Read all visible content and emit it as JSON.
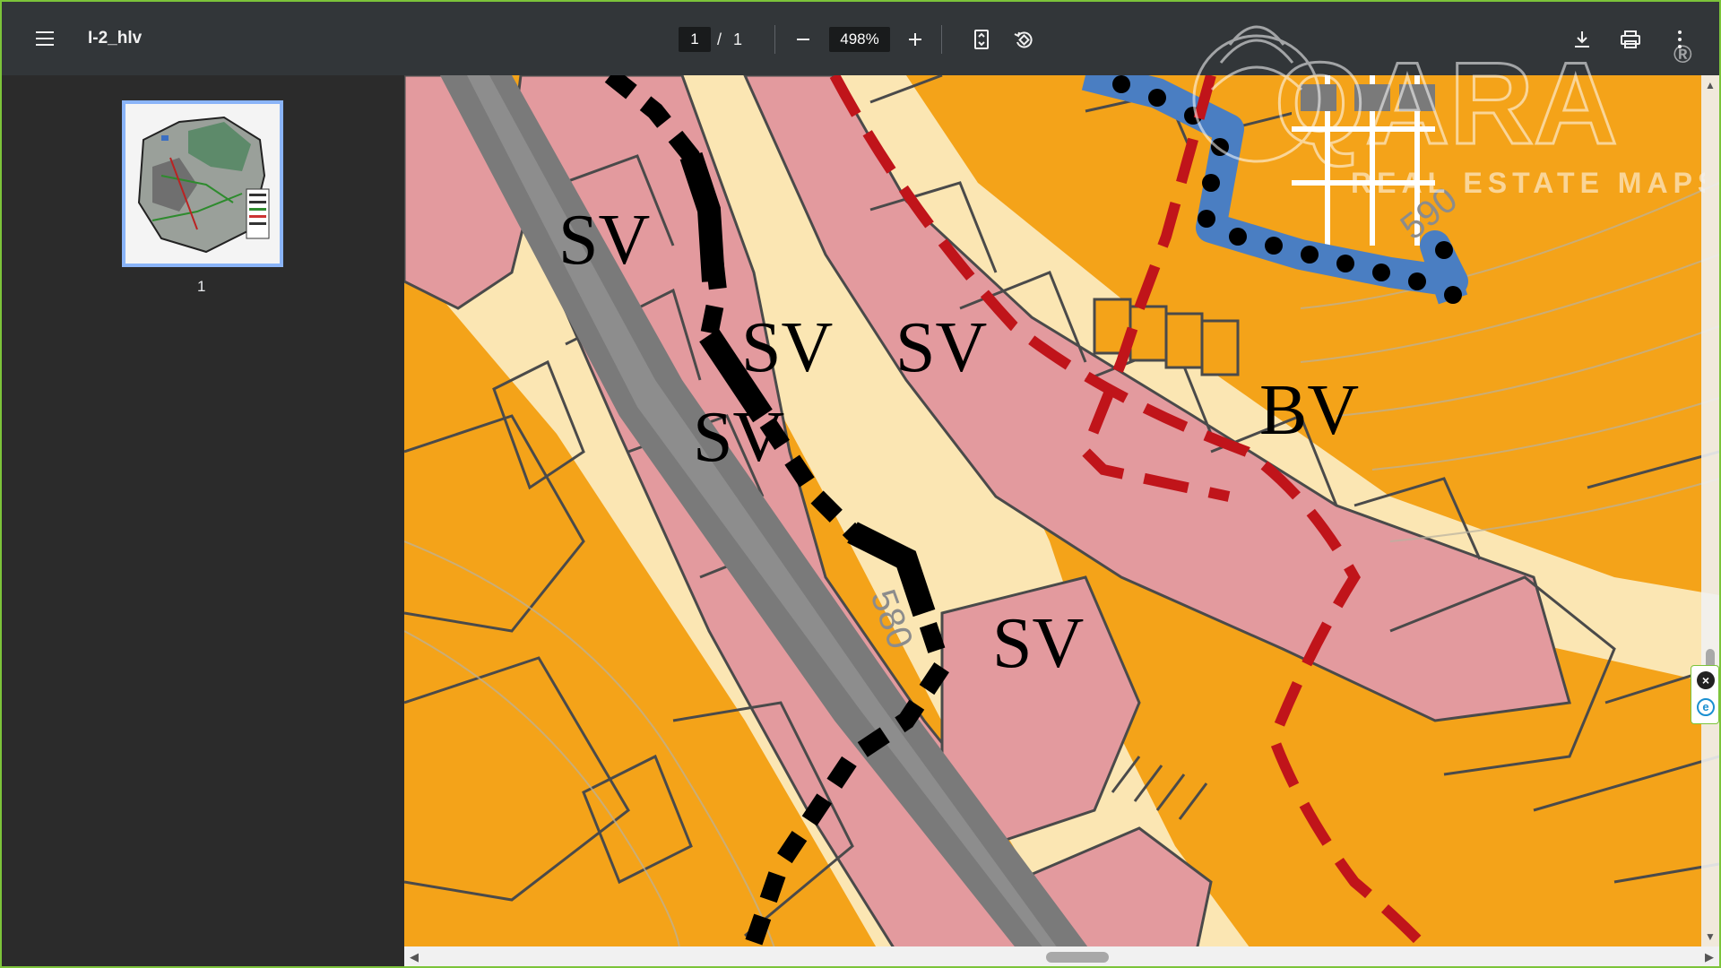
{
  "toolbar": {
    "title": "I-2_hlv",
    "page_current": "1",
    "page_separator": "/",
    "page_total": "1",
    "zoom": "498%"
  },
  "sidebar": {
    "thumbnail_label": "1"
  },
  "map": {
    "labels": [
      "SV",
      "SV",
      "SV",
      "SV",
      "SV",
      "BV"
    ],
    "contour_labels": [
      "580",
      "590"
    ]
  },
  "watermark": {
    "brand": "QARA",
    "sub": "REAL ESTATE MAPS",
    "mark": "®"
  },
  "colors": {
    "toolbar_bg": "#323639",
    "sidebar_bg": "#2b2b2b",
    "residential_pink": "#e39a9e",
    "orange_zone": "#f4a319",
    "road_cream": "#fbe6b3",
    "road_gray": "#7a7a7a",
    "boundary_red": "#c0141a",
    "blue_path": "#4a7ec2"
  }
}
